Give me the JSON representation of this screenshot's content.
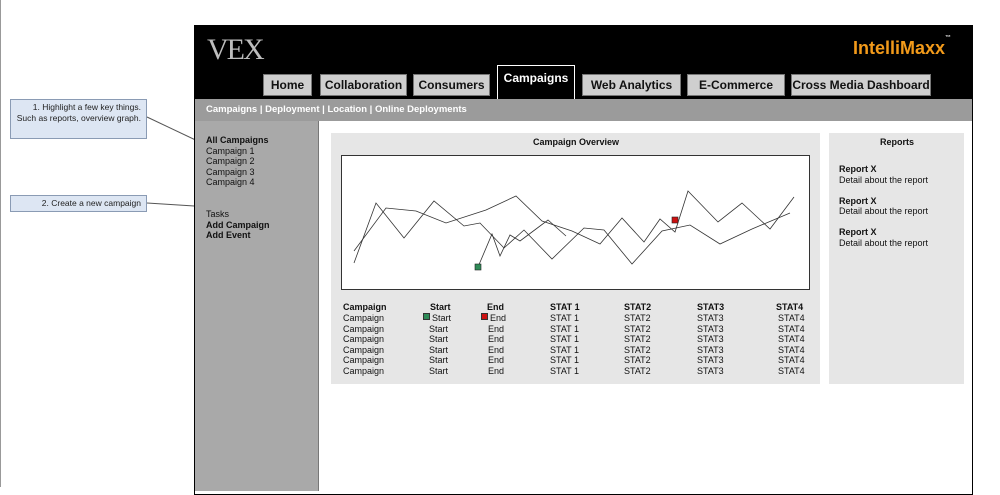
{
  "annotations": [
    {
      "number": "1.",
      "text": "Highlight a few key things. Such as reports, overview graph."
    },
    {
      "number": "2.",
      "text": "Create a new campaign"
    }
  ],
  "header": {
    "logo": "VEX",
    "brand": "IntelliMaxx",
    "brand_tm": "™"
  },
  "nav": {
    "tabs": [
      {
        "label": "Home",
        "active": false
      },
      {
        "label": "Collaboration",
        "active": false
      },
      {
        "label": "Consumers",
        "active": false
      },
      {
        "label": "Campaigns",
        "active": true
      },
      {
        "label": "Web Analytics",
        "active": false
      },
      {
        "label": "E-Commerce",
        "active": false
      },
      {
        "label": "Cross Media Dashboard",
        "active": false
      }
    ]
  },
  "breadcrumb": "Campaigns | Deployment | Location | Online Deployments",
  "sidebar": {
    "campaigns_heading": "All Campaigns",
    "campaigns": [
      "Campaign 1",
      "Campaign 2",
      "Campaign 3",
      "Campaign 4"
    ],
    "tasks_heading": "Tasks",
    "tasks": [
      "Add Campaign",
      "Add Event"
    ]
  },
  "overview": {
    "title": "Campaign Overview",
    "start_marker_color": "#2e8b57",
    "end_marker_color": "#cc1111"
  },
  "table": {
    "headers": [
      "Campaign",
      "Start",
      "End",
      "STAT 1",
      "STAT2",
      "STAT3",
      "STAT4"
    ],
    "rows": [
      [
        "Campaign",
        "Start",
        "End",
        "STAT 1",
        "STAT2",
        "STAT3",
        "STAT4"
      ],
      [
        "Campaign",
        "Start",
        "End",
        "STAT 1",
        "STAT2",
        "STAT3",
        "STAT4"
      ],
      [
        "Campaign",
        "Start",
        "End",
        "STAT 1",
        "STAT2",
        "STAT3",
        "STAT4"
      ],
      [
        "Campaign",
        "Start",
        "End",
        "STAT 1",
        "STAT2",
        "STAT3",
        "STAT4"
      ],
      [
        "Campaign",
        "Start",
        "End",
        "STAT 1",
        "STAT2",
        "STAT3",
        "STAT4"
      ],
      [
        "Campaign",
        "Start",
        "End",
        "STAT 1",
        "STAT2",
        "STAT3",
        "STAT4"
      ]
    ]
  },
  "reports": {
    "title": "Reports",
    "items": [
      {
        "title": "Report X",
        "detail": "Detail about the report"
      },
      {
        "title": "Report X",
        "detail": "Detail about the report"
      },
      {
        "title": "Report X",
        "detail": "Detail about the report"
      }
    ]
  },
  "colors": {
    "brand": "#f29a1a",
    "header_bg": "#000000",
    "sidebar_bg": "#a9a9a9",
    "panel_bg": "#e6e6e6",
    "note_bg": "#dde6f3"
  }
}
